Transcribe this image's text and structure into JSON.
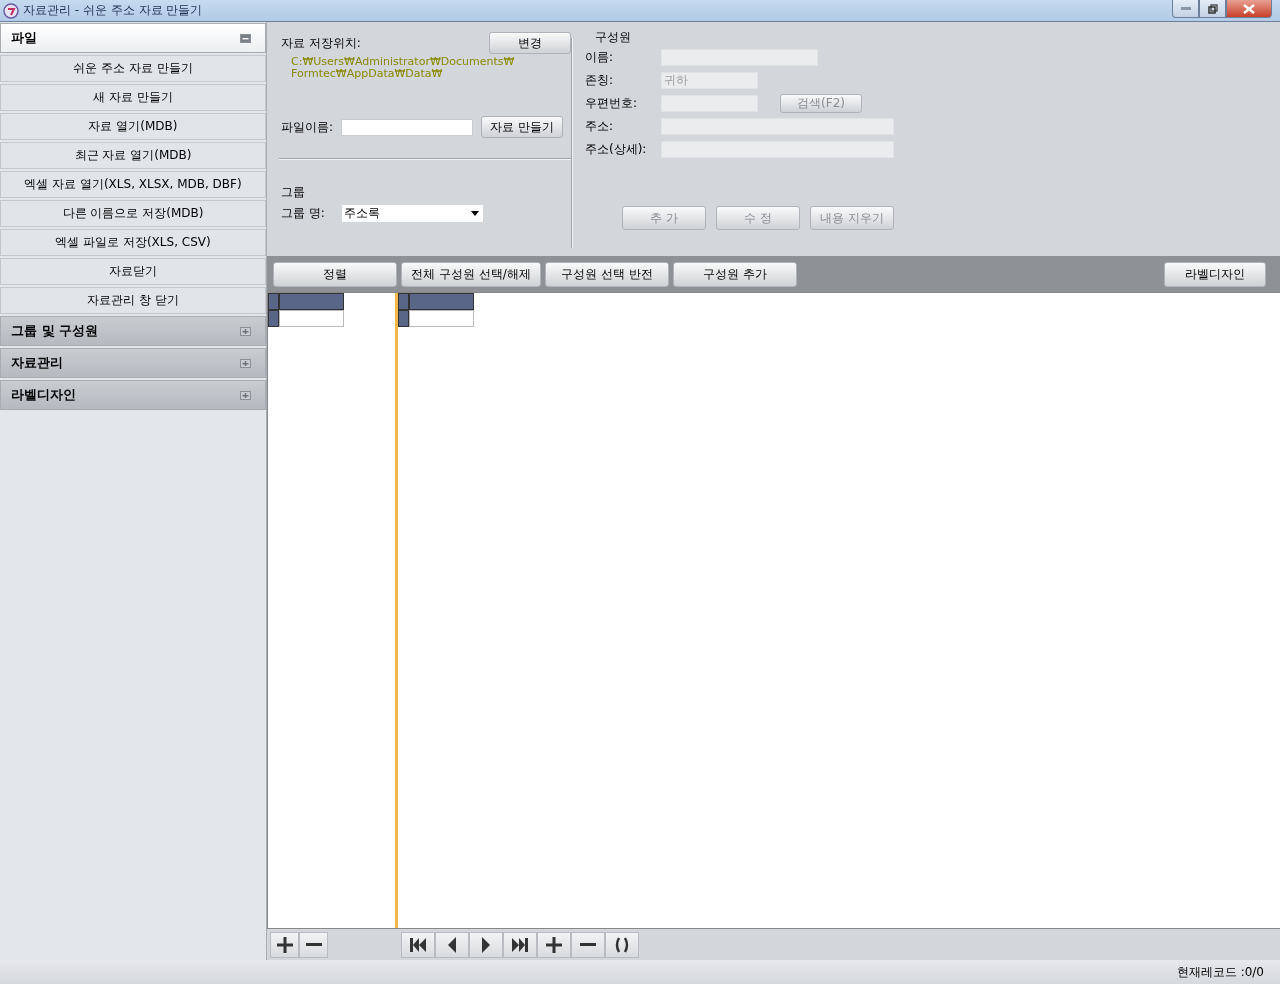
{
  "window": {
    "title": "자료관리 - 쉬운 주소 자료 만들기"
  },
  "sidebar": {
    "sections": [
      {
        "title": "파일",
        "expanded": true,
        "items": [
          "쉬운 주소 자료 만들기",
          "새 자료 만들기",
          "자료 열기(MDB)",
          "최근 자료 열기(MDB)",
          "엑셀 자료 열기(XLS, XLSX, MDB, DBF)",
          "다른 이름으로 저장(MDB)",
          "엑셀 파일로 저장(XLS, CSV)",
          "자료닫기",
          "자료관리 창 닫기"
        ]
      },
      {
        "title": "그룹 및 구성원",
        "expanded": false
      },
      {
        "title": "자료관리",
        "expanded": false
      },
      {
        "title": "라벨디자인",
        "expanded": false
      }
    ]
  },
  "storage": {
    "label": "자료 저장위치:",
    "change_button": "변경",
    "path_lines": [
      "C:₩Users₩Administrator₩Documents₩",
      "Formtec₩AppData₩Data₩"
    ],
    "file_label": "파일이름:",
    "create_button": "자료 만들기"
  },
  "group": {
    "heading": "그룹",
    "name_label": "그룹 명:",
    "name_value": "주소록"
  },
  "member": {
    "heading": "구성원",
    "fields": [
      {
        "label": "이름:",
        "disabled": true
      },
      {
        "label": "존칭:",
        "value": "귀하",
        "disabled": true
      },
      {
        "label": "우편번호:",
        "disabled": true,
        "button": "검색(F2)",
        "button_disabled": true
      },
      {
        "label": "주소:",
        "disabled": true
      },
      {
        "label": "주소(상세):",
        "disabled": true
      }
    ],
    "buttons": [
      {
        "label": "추 가",
        "disabled": true
      },
      {
        "label": "수 정",
        "disabled": true
      },
      {
        "label": "내용 지우기",
        "disabled": true
      }
    ]
  },
  "toolbar": {
    "buttons": [
      "정렬",
      "전체 구성원 선택/해제",
      "구성원 선택 반전",
      "구성원 추가"
    ],
    "right_button": "라벨디자인"
  },
  "grids": [
    {
      "rows": [
        {
          "selected": true
        },
        {
          "selected": false
        }
      ]
    },
    {
      "rows": [
        {
          "selected": true
        },
        {
          "selected": false
        }
      ]
    }
  ],
  "group_nav": [
    {
      "kind": "add"
    },
    {
      "kind": "remove"
    }
  ],
  "record_nav": [
    {
      "kind": "first"
    },
    {
      "kind": "prev"
    },
    {
      "kind": "next"
    },
    {
      "kind": "last"
    },
    {
      "kind": "add"
    },
    {
      "kind": "remove"
    },
    {
      "kind": "refresh"
    }
  ],
  "status_bar": {
    "text": "현재레코드 :0/0"
  }
}
